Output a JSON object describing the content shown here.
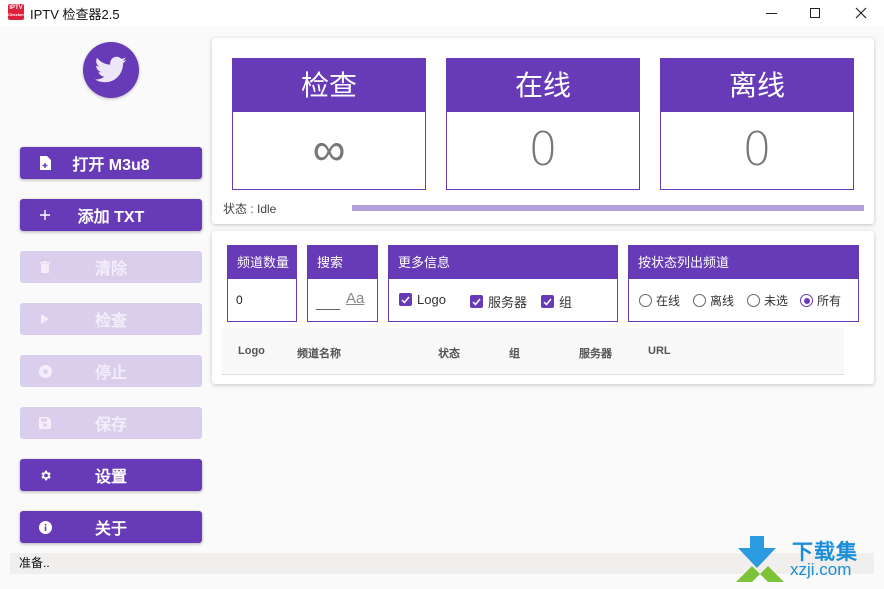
{
  "window": {
    "title": "IPTV 检查器2.5",
    "app_icon_text": "IPTV",
    "app_icon_subtext": "Checker"
  },
  "sidebar": {
    "buttons": [
      {
        "label": "打开 M3u8",
        "icon": "file-add-icon",
        "enabled": true
      },
      {
        "label": "添加 TXT",
        "icon": "plus-icon",
        "enabled": true
      },
      {
        "label": "清除",
        "icon": "trash-icon",
        "enabled": false
      },
      {
        "label": "检查",
        "icon": "play-icon",
        "enabled": false
      },
      {
        "label": "停止",
        "icon": "stop-icon",
        "enabled": false
      },
      {
        "label": "保存",
        "icon": "save-icon",
        "enabled": false
      },
      {
        "label": "设置",
        "icon": "gear-icon",
        "enabled": true
      },
      {
        "label": "关于",
        "icon": "info-icon",
        "enabled": true
      }
    ]
  },
  "stats": {
    "check": {
      "label": "检查",
      "value": "∞"
    },
    "online": {
      "label": "在线",
      "value": "0"
    },
    "offline": {
      "label": "离线",
      "value": "0"
    }
  },
  "status": {
    "label": "状态 : Idle",
    "progress_percent": 100
  },
  "filters": {
    "channel_count": {
      "label": "频道数量",
      "value": "0"
    },
    "search": {
      "label": "搜索",
      "value": "",
      "case_toggle": "Aa"
    },
    "more_info": {
      "label": "更多信息",
      "options": [
        {
          "label": "Logo",
          "checked": true
        },
        {
          "label": "服务器",
          "checked": true
        },
        {
          "label": "组",
          "checked": true
        }
      ]
    },
    "list_by_status": {
      "label": "按状态列出频道",
      "options": [
        {
          "label": "在线",
          "selected": false
        },
        {
          "label": "离线",
          "selected": false
        },
        {
          "label": "未选",
          "selected": false
        },
        {
          "label": "所有",
          "selected": true
        }
      ]
    }
  },
  "table": {
    "columns": [
      "Logo",
      "频道名称",
      "状态",
      "组",
      "服务器",
      "URL"
    ],
    "rows": []
  },
  "statusbar": {
    "text": "准备.."
  },
  "watermark": {
    "line1": "下载集",
    "line2": "xzji.com"
  },
  "colors": {
    "accent": "#673ab7",
    "accent_disabled": "#d9cfec",
    "progress": "#b39ddb"
  }
}
